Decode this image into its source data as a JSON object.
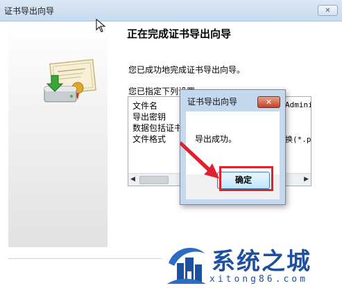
{
  "window": {
    "title": "证书导出向导",
    "close_glyph": "✕"
  },
  "wizard": {
    "heading": "正在完成证书导出向导",
    "intro": "您已成功地完成证书导出向导。",
    "spec_label": "您已指定下列设置",
    "settings": [
      {
        "name": "文件名",
        "value": "Adminis"
      },
      {
        "name": "导出密钥",
        "value": ""
      },
      {
        "name": "数据包括证书",
        "value": ""
      },
      {
        "name": "文件格式",
        "value": "换(*.p"
      }
    ],
    "scroll_left": "◀",
    "scroll_right": "▶"
  },
  "dialog": {
    "title": "证书导出向导",
    "close_glyph": "✕",
    "message": "导出成功。",
    "ok_label": "确定"
  },
  "watermark": {
    "title": "系统之城",
    "url": "xitong86.com"
  },
  "icons": [
    "certificate-export-icon",
    "cursor-icon",
    "red-arrow-icon",
    "castle-logo-icon"
  ],
  "colors": {
    "highlight": "#e0202c",
    "dialog_frame": "#c4d8ee",
    "watermark": "#1f4fa0"
  }
}
